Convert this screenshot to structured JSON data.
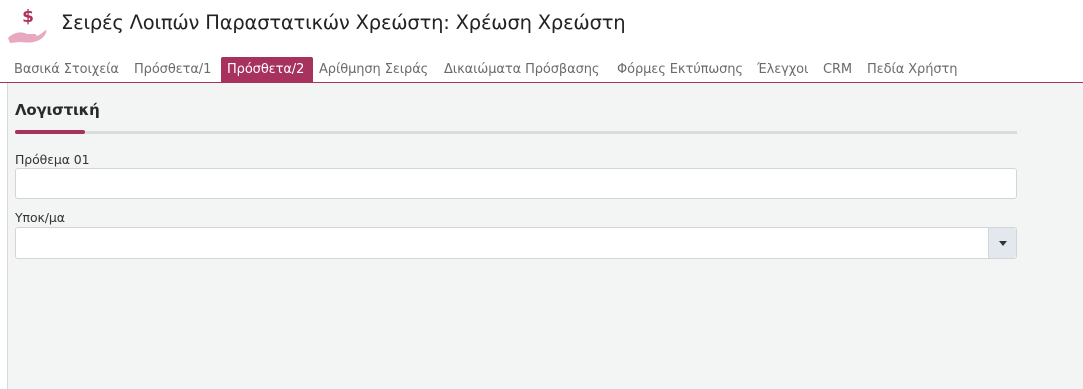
{
  "header": {
    "title": "Σειρές Λοιπών Παραστατικών Χρεώστη: Χρέωση Χρεώστη",
    "icon": "hand-dollar-icon"
  },
  "tabs": [
    {
      "label": "Βασικά Στοιχεία",
      "active": false
    },
    {
      "label": "Πρόσθετα/1",
      "active": false
    },
    {
      "label": "Πρόσθετα/2",
      "active": true
    },
    {
      "label": "Αρίθμηση Σειράς",
      "active": false
    },
    {
      "label": "Δικαιώματα Πρόσβασης",
      "active": false
    },
    {
      "label": "Φόρμες Εκτύπωσης",
      "active": false
    },
    {
      "label": "Έλεγχοι",
      "active": false
    },
    {
      "label": "CRM",
      "active": false
    },
    {
      "label": "Πεδία Χρήστη",
      "active": false
    }
  ],
  "section": {
    "title": "Λογιστική"
  },
  "fields": {
    "prefix": {
      "label": "Πρόθεμα 01",
      "value": ""
    },
    "branch": {
      "label": "Υποκ/μα",
      "value": ""
    }
  },
  "colors": {
    "accent": "#a8325e",
    "icon_dollar": "#b0325e",
    "icon_hand": "#e8a8c0",
    "panel_bg": "#f3f4f4"
  }
}
